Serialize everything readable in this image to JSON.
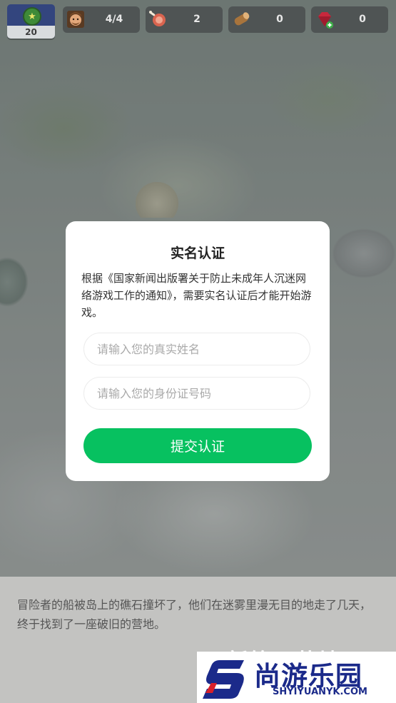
{
  "topbar": {
    "level": "20",
    "resources": [
      {
        "icon": "worker-face-icon",
        "value": "4/4"
      },
      {
        "icon": "meat-icon",
        "value": "2"
      },
      {
        "icon": "wood-log-icon",
        "value": "0"
      },
      {
        "icon": "gem-add-icon",
        "value": "0"
      }
    ]
  },
  "dialog": {
    "title": "实名认证",
    "description": "根据《国家新闻出版署关于防止未成年人沉迷网络游戏工作的通知》，需要实名认证后才能开始游戏。",
    "name_placeholder": "请输入您的真实姓名",
    "id_placeholder": "请输入您的身份证号码",
    "submit_label": "提交认证"
  },
  "story": {
    "text": "冒险者的船被岛上的礁石撞坏了，他们在迷雾里漫无目的地走了几天，终于找到了一座破旧的营地。",
    "faded_title": "新篇开营地"
  },
  "watermark": {
    "cn": "尚游乐园",
    "en": "SHYIYUANYK.COM"
  },
  "colors": {
    "submit": "#07c160",
    "level_badge": "#33457e",
    "watermark": "#1b2a8a"
  }
}
